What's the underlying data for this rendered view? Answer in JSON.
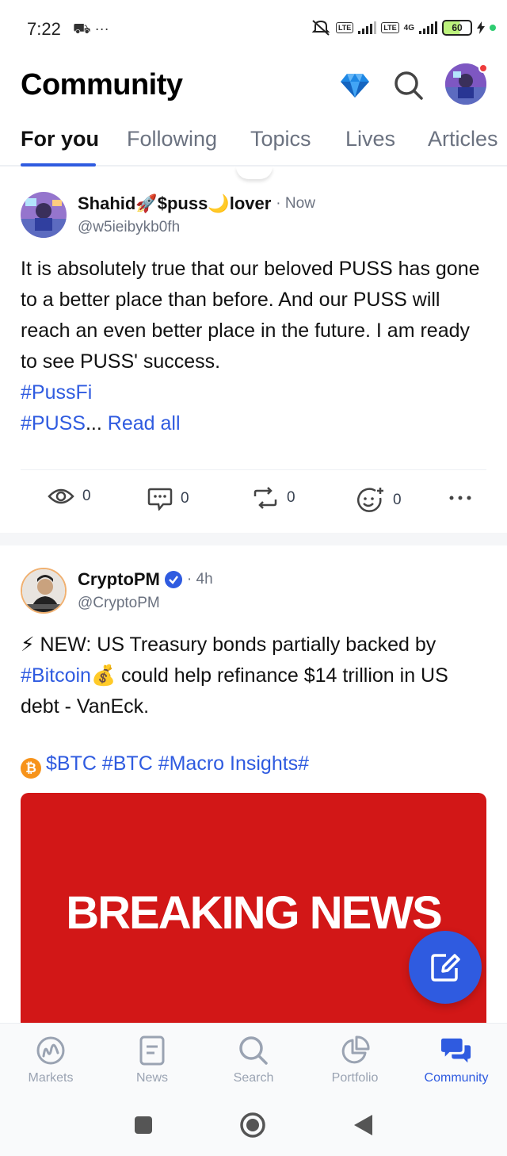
{
  "status_bar": {
    "time": "7:22",
    "left_icons": "⛟ ···",
    "network_label": "4G",
    "battery": "60"
  },
  "header": {
    "title": "Community"
  },
  "tabs": [
    {
      "label": "For you",
      "active": true
    },
    {
      "label": "Following",
      "active": false
    },
    {
      "label": "Topics",
      "active": false
    },
    {
      "label": "Lives",
      "active": false
    },
    {
      "label": "Articles",
      "active": false
    }
  ],
  "posts": [
    {
      "author": "Shahid🚀$puss🌙lover",
      "time": "· Now",
      "handle": "@w5ieibykb0fh",
      "text": "It is absolutely true that our beloved PUSS has gone to a better place than before. And our PUSS will reach an even better place in the future. I am ready to see PUSS' success.",
      "hashtag1": "#PussFi",
      "hashtag2": "#PUSS",
      "ellipsis": "...",
      "read_all": "Read all",
      "stats": {
        "views": "0",
        "comments": "0",
        "reposts": "0",
        "reactions": "0"
      }
    },
    {
      "author": "CryptoPM",
      "time": "· 4h",
      "handle": "@CryptoPM",
      "line1_prefix": "⚡ NEW: US Treasury bonds partially backed by ",
      "bitcoin_tag": "#Bitcoin",
      "line1_suffix": "💰 could help refinance $14 trillion in US debt - VanEck.",
      "coin_symbol": "₿",
      "tags": "$BTC #BTC #Macro Insights#",
      "image_text": "BREAKING NEWS"
    }
  ],
  "bottom_nav": [
    {
      "label": "Markets",
      "active": false
    },
    {
      "label": "News",
      "active": false
    },
    {
      "label": "Search",
      "active": false
    },
    {
      "label": "Portfolio",
      "active": false
    },
    {
      "label": "Community",
      "active": true
    }
  ],
  "colors": {
    "accent": "#2f5be0",
    "breaking_bg": "#d21717",
    "muted": "#6b7280"
  }
}
